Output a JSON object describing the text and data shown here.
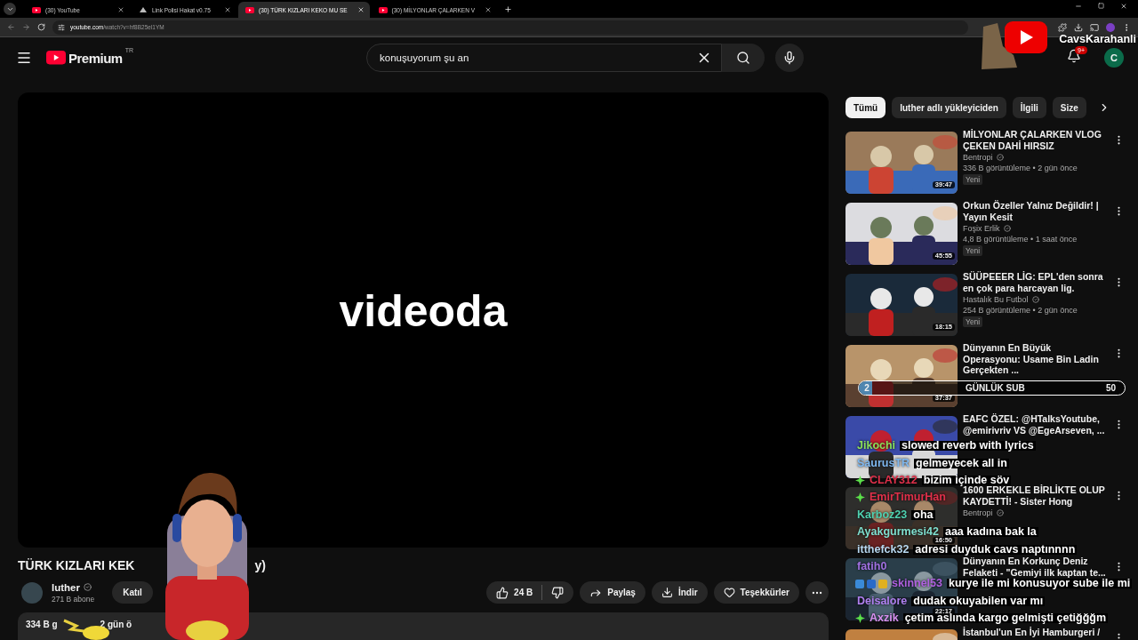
{
  "browser": {
    "tabs": [
      {
        "title": "(30) YouTube",
        "kind": "youtube",
        "selected": false
      },
      {
        "title": "Link Polisi Hakat v0.75",
        "kind": "other",
        "selected": false
      },
      {
        "title": "(30) TÜRK KIZLARI KEKO MU SE",
        "kind": "youtube",
        "selected": true
      },
      {
        "title": "(30) MİLYONLAR ÇALARKEN V",
        "kind": "youtube",
        "selected": false
      }
    ],
    "url_host": "youtube.com",
    "url_path": "/watch?v=hf8B25el1YM"
  },
  "header": {
    "logo": "Premium",
    "region": "TR",
    "search": {
      "value": "konuşuyorum şu an"
    },
    "notifications": "9+",
    "avatar": "C"
  },
  "overlay_logo": {
    "name": "CavsKarahanli"
  },
  "player": {
    "caption": "videoda"
  },
  "video": {
    "title_start": "TÜRK KIZLARI KEK",
    "title_end": "y)",
    "channel": "luther",
    "subscribers": "271 B abone",
    "join": "Katıl",
    "likes": "24 B",
    "actions": [
      {
        "kind": "share",
        "label": "Paylaş"
      },
      {
        "kind": "download",
        "label": "İndir"
      },
      {
        "kind": "thanks",
        "label": "Teşekkürler"
      }
    ],
    "description_start": "334 B g",
    "description_end": "2 gün ö"
  },
  "chips": [
    {
      "label": "Tümü",
      "selected": true
    },
    {
      "label": "luther adlı yükleyiciden",
      "selected": false
    },
    {
      "label": "İlgili",
      "selected": false
    },
    {
      "label": "Size",
      "selected": false
    }
  ],
  "recommendations": [
    {
      "title": "MİLYONLAR ÇALARKEN VLOG ÇEKEN DAHİ HIRSIZ",
      "channel": "Bentropi",
      "meta": "336 B görüntüleme • 2 gün önce",
      "badge": "Yeni",
      "duration": "39:47"
    },
    {
      "title": "Orkun Özeller Yalnız Değildir! | Yayın Kesit",
      "channel": "Foşix Erlik",
      "meta": "4,8 B görüntüleme • 1 saat önce",
      "badge": "Yeni",
      "duration": "45:55"
    },
    {
      "title": "SÜÜPEEER LİG: EPL'den sonra en çok para harcayan lig.",
      "channel": "Hastalık Bu Futbol",
      "meta": "254 B görüntüleme • 2 gün önce",
      "badge": "Yeni",
      "duration": "18:15"
    },
    {
      "title": "Dünyanın En Büyük Operasyonu: Usame Bin Ladin Gerçekten ...",
      "duration": "37:37"
    },
    {
      "title": "EAFC ÖZEL: @HTalksYoutube, @emirivriv VS @EgeArseven, ..."
    },
    {
      "title": "1600 ERKEKLE BİRLİKTE OLUP KAYDETTİ! - Sister Hong",
      "channel": "Bentropi",
      "duration": "16:50"
    },
    {
      "title": "Dünyanın En Korkunç Deniz Felaketi - \"Gemiyi ilk kaptan te...",
      "duration": "22:17"
    },
    {
      "title": "İstanbul'un En İyi Hamburgeri /"
    }
  ],
  "sub_goal": {
    "count": "2",
    "label": "GÜNLÜK SUB",
    "target": "50",
    "level": 0.05
  },
  "chat": [
    {
      "kind": "plain",
      "user": "Jikochi",
      "color": "#8be05a",
      "message": "slowed reverb with lyrics"
    },
    {
      "kind": "plain",
      "user": "SaurusTR",
      "color": "#7fb8f0",
      "message": "gelmeyecek all in"
    },
    {
      "kind": "diamond",
      "user": "CLAY312",
      "color": "#e0304a",
      "message": "bizim içinde söv"
    },
    {
      "kind": "diamond",
      "user": "EmirTimurHan",
      "color": "#e0304a"
    },
    {
      "kind": "plain",
      "user": "Karboz23",
      "color": "#4fd1b0",
      "message": "oha"
    },
    {
      "kind": "plain",
      "user": "Ayakgurmesi42",
      "color": "#7fe0d0",
      "message": "aaa kadına bak la"
    },
    {
      "kind": "plain",
      "user": "itthefck32",
      "color": "#b8d8f0",
      "message": "adresi duyduk cavs naptınnnn"
    },
    {
      "kind": "plain",
      "user": "fatih0",
      "color": "#a070e0"
    },
    {
      "kind": "multi",
      "user": "skinnel53",
      "color": "#b060e0",
      "message": "kurye ile mi konusuyor sube ile mi"
    },
    {
      "kind": "plain",
      "user": "Deisalore",
      "color": "#b080f0",
      "message": "dudak okuyabilen var mı"
    },
    {
      "kind": "diamond",
      "user": "Axzik",
      "color": "#d890f0",
      "message": "çetim aslında kargo gelmişti çetiğğğm"
    }
  ]
}
